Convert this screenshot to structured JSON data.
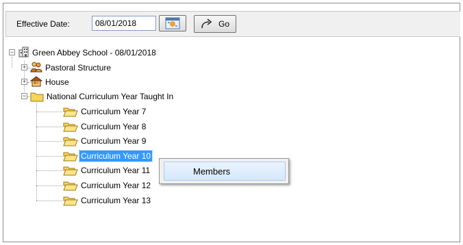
{
  "toolbar": {
    "effective_date_label": "Effective Date:",
    "effective_date_value": "08/01/2018",
    "go_label": "Go"
  },
  "tree": {
    "root": "Green Abbey School - 08/01/2018",
    "pastoral": "Pastoral Structure",
    "house": "House",
    "nc_year": "National Curriculum Year Taught In",
    "years": [
      "Curriculum Year  7",
      "Curriculum Year  8",
      "Curriculum Year  9",
      "Curriculum Year 10",
      "Curriculum Year 11",
      "Curriculum Year 12",
      "Curriculum Year 13"
    ],
    "selected_index": 3
  },
  "context_menu": {
    "items": [
      "Members"
    ]
  },
  "colors": {
    "selection": "#3399ff",
    "folder": "#f7d55a",
    "menu_hover": "#d6e8fb"
  }
}
